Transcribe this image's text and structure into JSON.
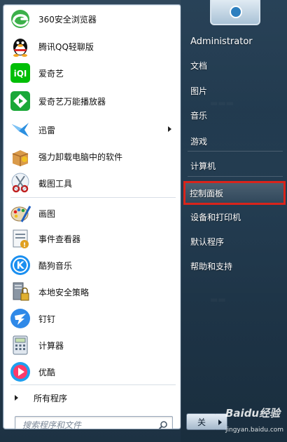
{
  "start_menu": {
    "programs": [
      {
        "label": "360安全浏览器",
        "icon": "360-browser-icon"
      },
      {
        "label": "腾讯QQ轻聊版",
        "icon": "qq-penguin-icon"
      },
      {
        "label": "爱奇艺",
        "icon": "iqiyi-icon"
      },
      {
        "label": "爱奇艺万能播放器",
        "icon": "iqiyi-player-icon"
      },
      {
        "label": "迅雷",
        "icon": "xunlei-bird-icon",
        "has_submenu": true
      },
      {
        "label": "强力卸载电脑中的软件",
        "icon": "uninstall-box-icon"
      },
      {
        "label": "截图工具",
        "icon": "snipping-scissors-icon"
      },
      {
        "label": "画图",
        "icon": "paint-palette-icon"
      },
      {
        "label": "事件查看器",
        "icon": "event-viewer-icon"
      },
      {
        "label": "酷狗音乐",
        "icon": "kugou-k-icon"
      },
      {
        "label": "本地安全策略",
        "icon": "security-policy-icon"
      },
      {
        "label": "钉钉",
        "icon": "dingtalk-icon"
      },
      {
        "label": "计算器",
        "icon": "calculator-icon"
      },
      {
        "label": "优酷",
        "icon": "youku-icon"
      }
    ],
    "all_programs_label": "所有程序",
    "search_placeholder": "搜索程序和文件",
    "right_pane": {
      "user_name": "Administrator",
      "items": [
        "文档",
        "图片",
        "音乐",
        "游戏",
        "计算机",
        "控制面板",
        "设备和打印机",
        "默认程序",
        "帮助和支持"
      ],
      "highlighted_item": "控制面板"
    },
    "shutdown_label": "关"
  },
  "watermark": {
    "brand": "Baidu经验",
    "url": "jingyan.baidu.com"
  },
  "colors": {
    "highlight_border": "#d9241b",
    "right_pane": "#264056"
  }
}
